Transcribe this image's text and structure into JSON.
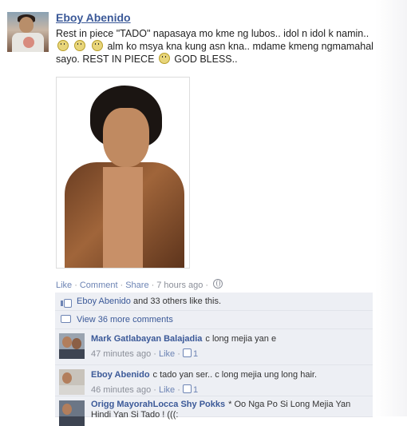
{
  "post": {
    "author": "Eboy Abenido",
    "message_line1": "Rest in piece \"TADO\" napasaya mo kme ng lubos.. idol n idol k namin..",
    "message_line2": "alm ko msya kna kung asn kna.. mdame kmeng ngmamahal",
    "message_line3_a": "sayo. REST IN PIECE",
    "message_line3_b": "GOD BLESS..",
    "actions": {
      "like": "Like",
      "comment": "Comment",
      "share": "Share",
      "time": "7 hours ago"
    }
  },
  "likes": {
    "name": "Eboy Abenido",
    "rest": "and 33 others like this."
  },
  "more_comments": "View 36 more comments",
  "comments": [
    {
      "name": "Mark Gatlabayan Balajadia",
      "text": "c long mejia yan e",
      "time": "47 minutes ago",
      "like_label": "Like",
      "like_count": "1"
    },
    {
      "name": "Eboy Abenido",
      "text": "c tado yan ser.. c long mejia ung long hair.",
      "time": "46 minutes ago",
      "like_label": "Like",
      "like_count": "1"
    },
    {
      "name": "Origg MayorahLocca Shy Pokks",
      "text": "* Oo Nga Po Si Long Mejia Yan",
      "text2": "Hindi Yan Si Tado ! (((:"
    }
  ],
  "icons": [
    "smiley-icon",
    "globe-icon",
    "thumbs-up-icon",
    "comment-icon"
  ]
}
